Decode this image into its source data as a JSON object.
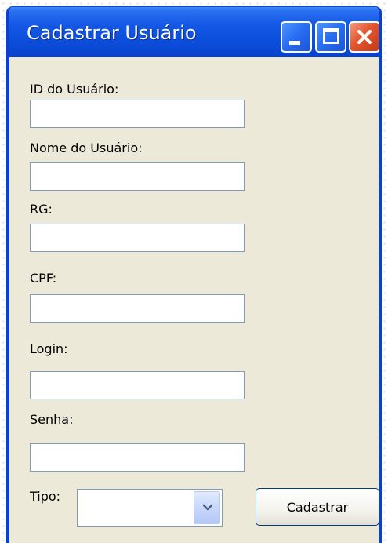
{
  "window": {
    "title": "Cadastrar Usuário",
    "controls": [
      "minimize-icon",
      "maximize-icon",
      "close-icon"
    ]
  },
  "form": {
    "fields": [
      {
        "label": "ID do Usuário:",
        "value": ""
      },
      {
        "label": "Nome do Usuário:",
        "value": ""
      },
      {
        "label": "RG:",
        "value": ""
      },
      {
        "label": "CPF:",
        "value": ""
      },
      {
        "label": "Login:",
        "value": ""
      },
      {
        "label": "Senha:",
        "value": ""
      }
    ],
    "tipo": {
      "label": "Tipo:",
      "value": ""
    },
    "submit_label": "Cadastrar"
  },
  "colors": {
    "title_bar": "#0b4ddb",
    "window_body": "#ece9d8",
    "close_button": "#e2552f",
    "input_border": "#7f9db9"
  }
}
